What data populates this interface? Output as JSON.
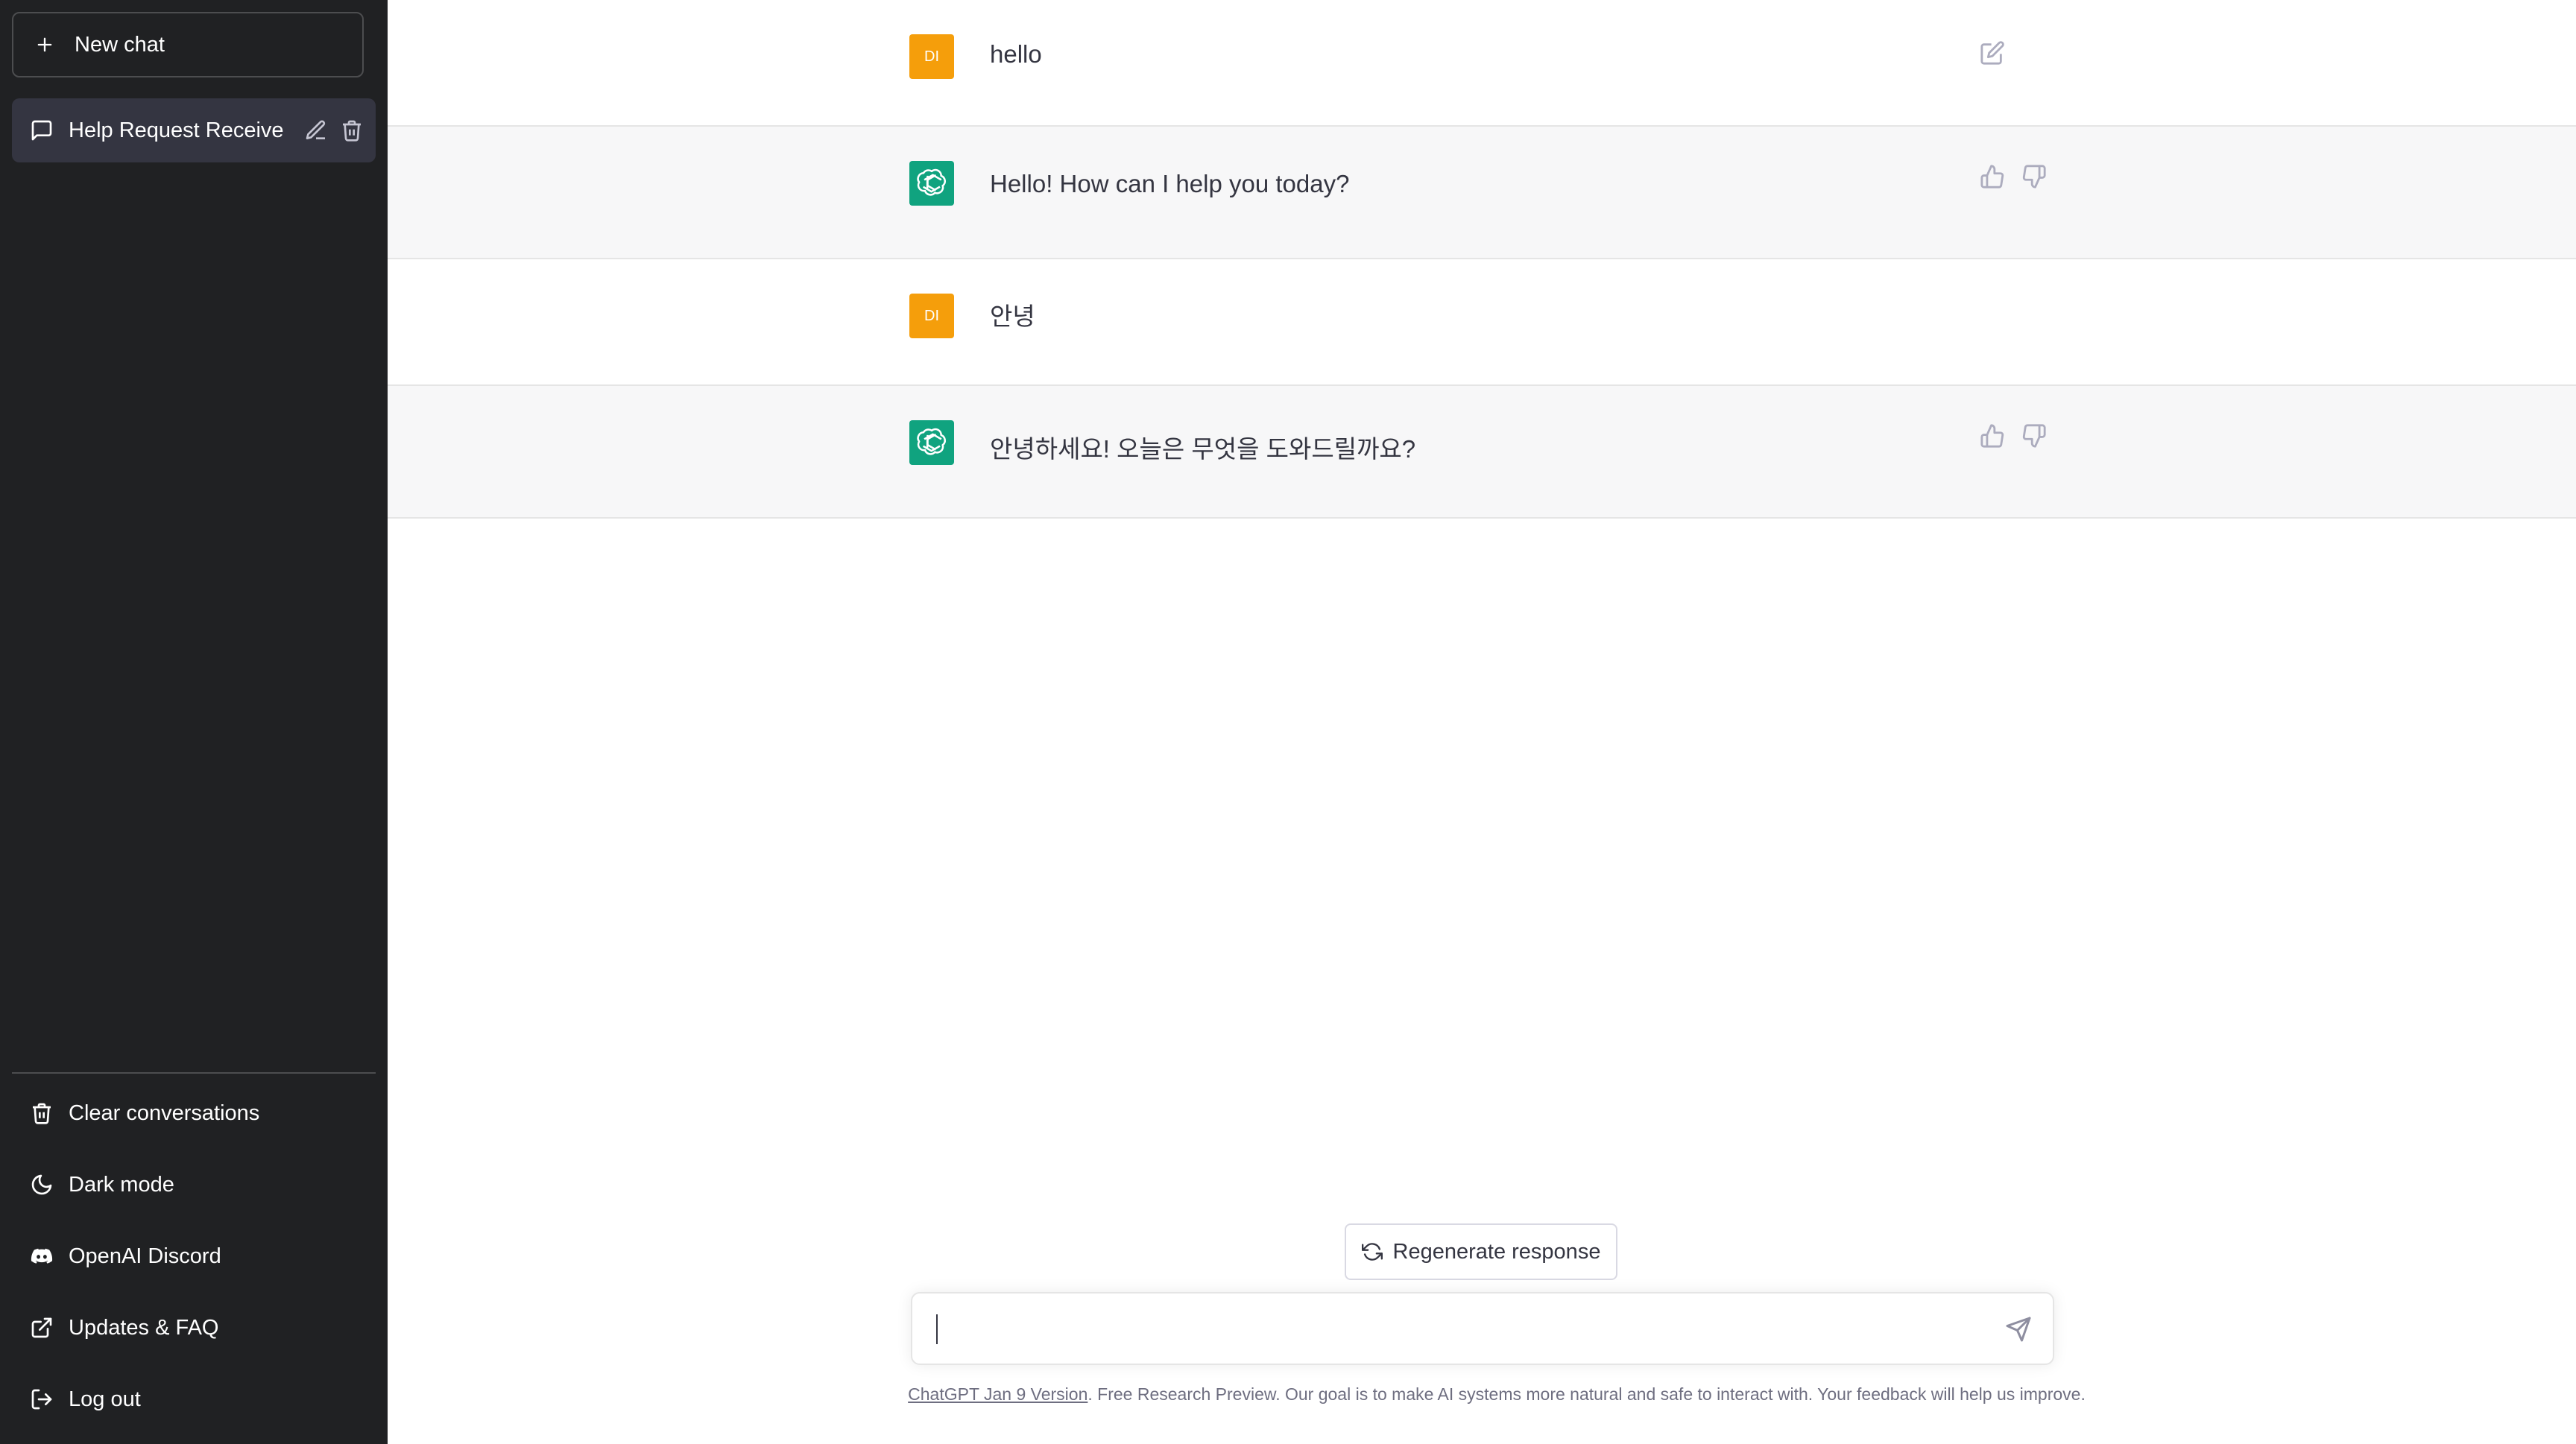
{
  "sidebar": {
    "new_chat_label": "New chat",
    "conversations": [
      {
        "title": "Help Request Receive"
      }
    ],
    "menu": [
      {
        "label": "Clear conversations",
        "icon": "trash-icon"
      },
      {
        "label": "Dark mode",
        "icon": "moon-icon"
      },
      {
        "label": "OpenAI Discord",
        "icon": "discord-icon"
      },
      {
        "label": "Updates & FAQ",
        "icon": "external-link-icon"
      },
      {
        "label": "Log out",
        "icon": "logout-icon"
      }
    ]
  },
  "messages": [
    {
      "role": "user",
      "avatar": "DI",
      "text": "hello"
    },
    {
      "role": "assistant",
      "text": "Hello! How can I help you today?"
    },
    {
      "role": "user",
      "avatar": "DI",
      "text": "안녕"
    },
    {
      "role": "assistant",
      "text": "안녕하세요! 오늘은 무엇을 도와드릴까요?"
    }
  ],
  "composer": {
    "regenerate_label": "Regenerate response",
    "input_value": ""
  },
  "footer": {
    "link_text": "ChatGPT Jan 9 Version",
    "text": ". Free Research Preview. Our goal is to make AI systems more natural and safe to interact with. Your feedback will help us improve."
  },
  "colors": {
    "sidebar_bg": "#202123",
    "user_avatar": "#f59e0b",
    "assistant_avatar": "#10a37f",
    "assistant_row_bg": "#f7f7f8"
  }
}
